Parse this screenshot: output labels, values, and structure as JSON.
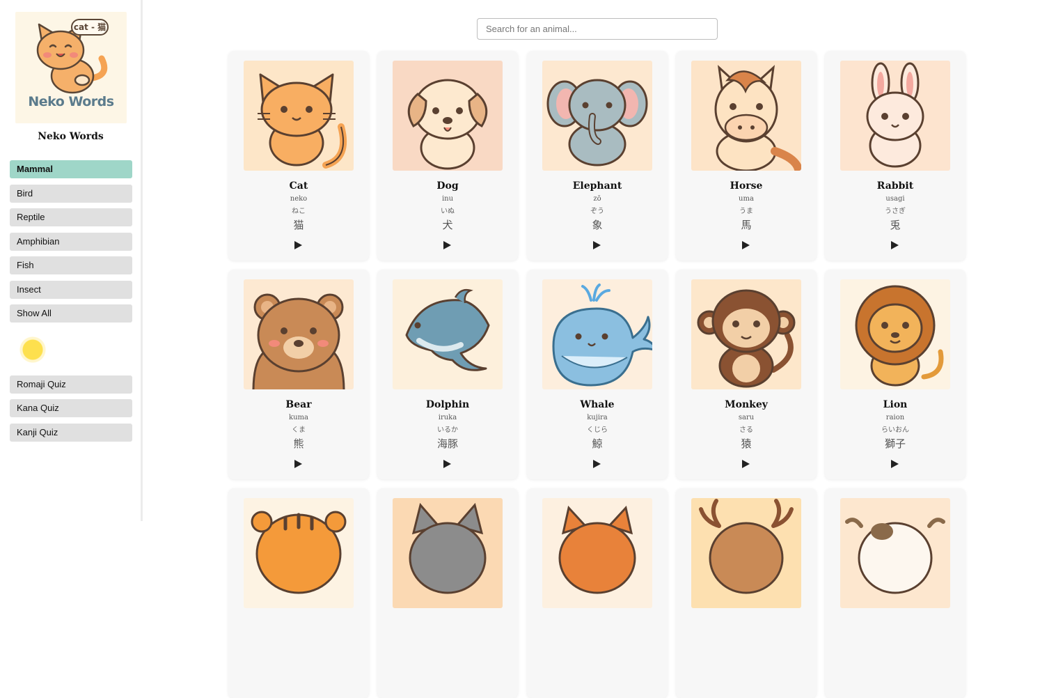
{
  "app": {
    "logo_text": "Neko Words",
    "logo_bubble": "cat - 猫",
    "name": "Neko Words"
  },
  "sidebar": {
    "categories": [
      {
        "label": "Mammal",
        "active": true
      },
      {
        "label": "Bird",
        "active": false
      },
      {
        "label": "Reptile",
        "active": false
      },
      {
        "label": "Amphibian",
        "active": false
      },
      {
        "label": "Fish",
        "active": false
      },
      {
        "label": "Insect",
        "active": false
      },
      {
        "label": "Show All",
        "active": false
      }
    ],
    "theme_toggle_icon": "sun-icon",
    "quizzes": [
      {
        "label": "Romaji Quiz"
      },
      {
        "label": "Kana Quiz"
      },
      {
        "label": "Kanji Quiz"
      }
    ]
  },
  "search": {
    "placeholder": "Search for an animal...",
    "value": ""
  },
  "cards": [
    {
      "en": "Cat",
      "romaji": "neko",
      "kana": "ねこ",
      "kanji": "猫",
      "animal": "cat",
      "bg": "#fde6c8"
    },
    {
      "en": "Dog",
      "romaji": "inu",
      "kana": "いぬ",
      "kanji": "犬",
      "animal": "dog",
      "bg": "#f9d9c4"
    },
    {
      "en": "Elephant",
      "romaji": "zō",
      "kana": "ぞう",
      "kanji": "象",
      "animal": "elephant",
      "bg": "#fde8d0"
    },
    {
      "en": "Horse",
      "romaji": "uma",
      "kana": "うま",
      "kanji": "馬",
      "animal": "horse",
      "bg": "#fde4c8"
    },
    {
      "en": "Rabbit",
      "romaji": "usagi",
      "kana": "うさぎ",
      "kanji": "兎",
      "animal": "rabbit",
      "bg": "#fde4cf"
    },
    {
      "en": "Bear",
      "romaji": "kuma",
      "kana": "くま",
      "kanji": "熊",
      "animal": "bear",
      "bg": "#fde9d2"
    },
    {
      "en": "Dolphin",
      "romaji": "iruka",
      "kana": "いるか",
      "kanji": "海豚",
      "animal": "dolphin",
      "bg": "#fdf0dc"
    },
    {
      "en": "Whale",
      "romaji": "kujira",
      "kana": "くじら",
      "kanji": "鯨",
      "animal": "whale",
      "bg": "#fdeedd"
    },
    {
      "en": "Monkey",
      "romaji": "saru",
      "kana": "さる",
      "kanji": "猿",
      "animal": "monkey",
      "bg": "#fde7cb"
    },
    {
      "en": "Lion",
      "romaji": "raion",
      "kana": "らいおん",
      "kanji": "獅子",
      "animal": "lion",
      "bg": "#fdf3e3"
    }
  ],
  "partial_cards": [
    {
      "animal": "tiger",
      "bg": "#fdf3e3"
    },
    {
      "animal": "wolf",
      "bg": "#fbd9b3"
    },
    {
      "animal": "fox",
      "bg": "#fdf0e0"
    },
    {
      "animal": "deer",
      "bg": "#fde0b0"
    },
    {
      "animal": "cow",
      "bg": "#fde7cf"
    }
  ]
}
